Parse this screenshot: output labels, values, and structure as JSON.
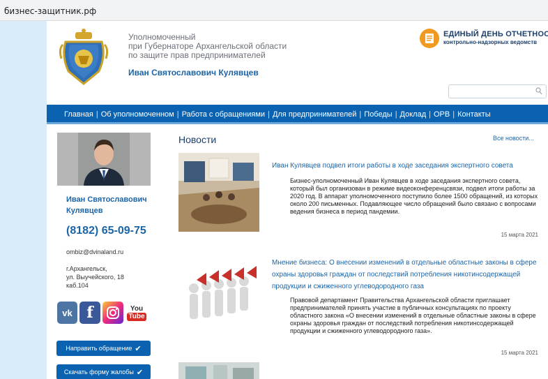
{
  "browser": {
    "url": "бизнес-защитник.рф"
  },
  "header": {
    "org_lines": [
      "Уполномоченный",
      "при Губернаторе Архангельской области",
      "по защите прав предпринимателей"
    ],
    "org_name": "Иван Святославович Кулявцев",
    "edo_title": "ЕДИНЫЙ ДЕНЬ ОТЧЕТНОСТИ",
    "edo_subtitle": "контрольно-надзорных ведомств",
    "search_placeholder": ""
  },
  "nav": {
    "items": [
      "Главная",
      "Об уполномоченном",
      "Работа с обращениями",
      "Для предпринимателей",
      "Победы",
      "Доклад",
      "ОРВ",
      "Контакты"
    ],
    "separator": "|"
  },
  "sidebar": {
    "name_line1": "Иван Святославович",
    "name_line2": "Кулявцев",
    "phone": "(8182) 65-09-75",
    "email": "ombiz@dvinaland.ru",
    "address": [
      "г.Архангельск,",
      "ул. Выучейского, 18",
      "каб.104"
    ],
    "social": {
      "vk": "vk",
      "fb": "f",
      "yt_top": "You",
      "yt_bottom": "Tube"
    },
    "btn_send": "Направить обращение",
    "btn_download": "Скачать форму жалобы",
    "check": "✔"
  },
  "news": {
    "heading": "Новости",
    "all_link": "Все новости...",
    "items": [
      {
        "title": "Иван Кулявцев подвел итоги работы в ходе заседания экспертного совета",
        "text": "Бизнес-уполномоченный Иван Кулявцев в ходе заседания экспертного совета, который был организован в режиме видеоконференцсвязи, подвел итоги работы за 2020 год. В аппарат уполномоченного поступило более 1500 обращений, из которых около 200 письменных. Подавляющее число обращений было связано с вопросами ведения бизнеса в период пандемии.",
        "date": "15 марта 2021"
      },
      {
        "title": "Мнение бизнеса: О внесении изменений в отдельные областные законы в сфере охраны здоровья граждан от последствий потребления никотинсодержащей продукции и сжиженного углеводородного газа",
        "text": "Правовой департамент Правительства Архангельской области приглашает предпринимателей принять участие в публичных консультациях по проекту областного закона «О внесении изменений в отдельные областные законы в сфере охраны здоровья граждан от последствий потребления никотинсодержащей продукции и сжиженного углеводородного газа».",
        "date": "15 марта 2021"
      }
    ]
  },
  "colors": {
    "nav_bg": "#0a62b0",
    "link": "#1b64a8",
    "gutter": "#d9ecfa"
  }
}
